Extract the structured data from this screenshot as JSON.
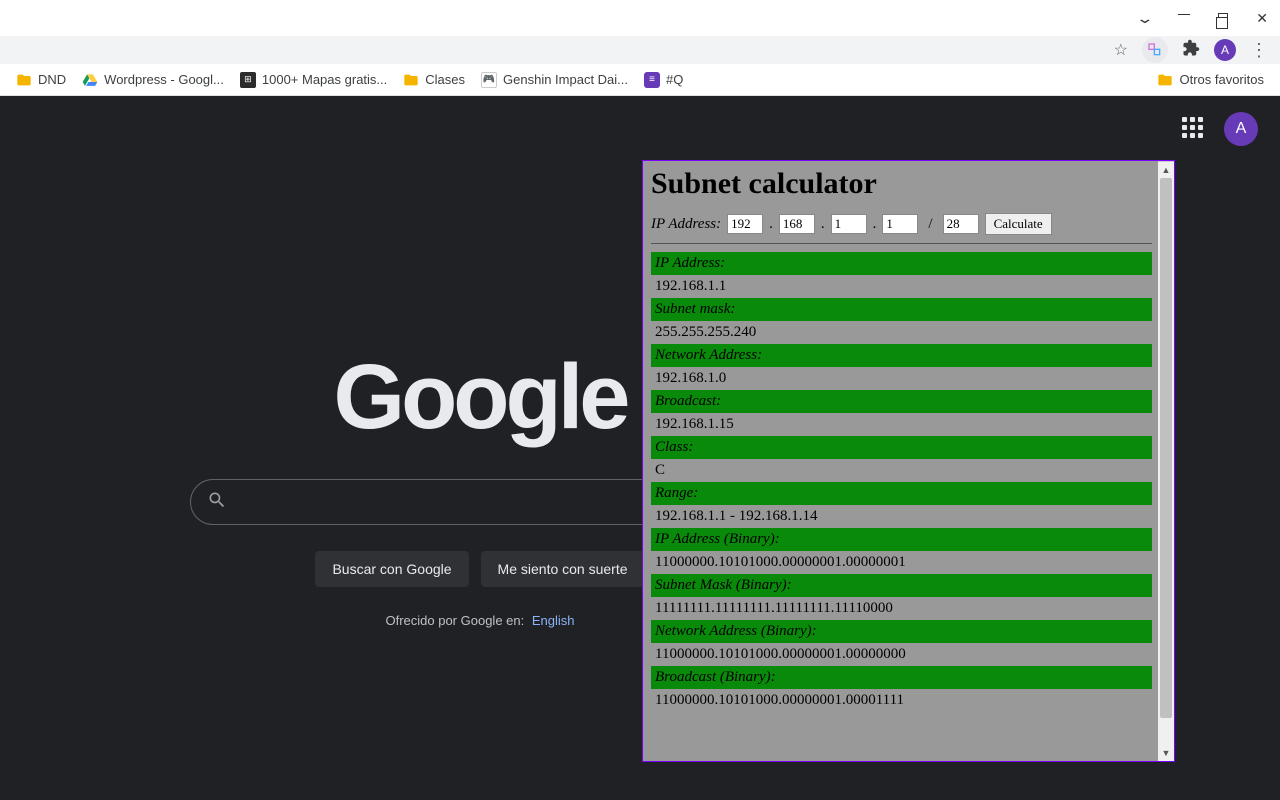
{
  "window": {
    "avatar_letter": "A"
  },
  "bookmarks": {
    "items": [
      {
        "label": "DND",
        "icon": "folder"
      },
      {
        "label": "Wordpress - Googl...",
        "icon": "drive"
      },
      {
        "label": "1000+ Mapas gratis...",
        "icon": "dark"
      },
      {
        "label": "Clases",
        "icon": "folder"
      },
      {
        "label": "Genshin Impact Dai...",
        "icon": "genshin"
      },
      {
        "label": "#Q",
        "icon": "purple"
      }
    ],
    "other_label": "Otros favoritos"
  },
  "google": {
    "logo": "Google",
    "search_btn": "Buscar con Google",
    "lucky_btn": "Me siento con suerte",
    "offered_prefix": "Ofrecido por Google en:",
    "offered_lang": "English",
    "avatar_letter": "A"
  },
  "popup": {
    "title": "Subnet calculator",
    "ip_label": "IP Address:",
    "octets": [
      "192",
      "168",
      "1",
      "1"
    ],
    "cidr": "28",
    "calc_label": "Calculate",
    "rows": [
      {
        "label": "IP Address:",
        "value": "192.168.1.1"
      },
      {
        "label": "Subnet mask:",
        "value": "255.255.255.240"
      },
      {
        "label": "Network Address:",
        "value": "192.168.1.0"
      },
      {
        "label": "Broadcast:",
        "value": "192.168.1.15"
      },
      {
        "label": "Class:",
        "value": "C"
      },
      {
        "label": "Range:",
        "value": "192.168.1.1 - 192.168.1.14"
      },
      {
        "label": "IP Address (Binary):",
        "value": "11000000.10101000.00000001.00000001"
      },
      {
        "label": "Subnet Mask (Binary):",
        "value": "11111111.11111111.11111111.11110000"
      },
      {
        "label": "Network Address (Binary):",
        "value": "11000000.10101000.00000001.00000000"
      },
      {
        "label": "Broadcast (Binary):",
        "value": "11000000.10101000.00000001.00001111"
      }
    ]
  }
}
